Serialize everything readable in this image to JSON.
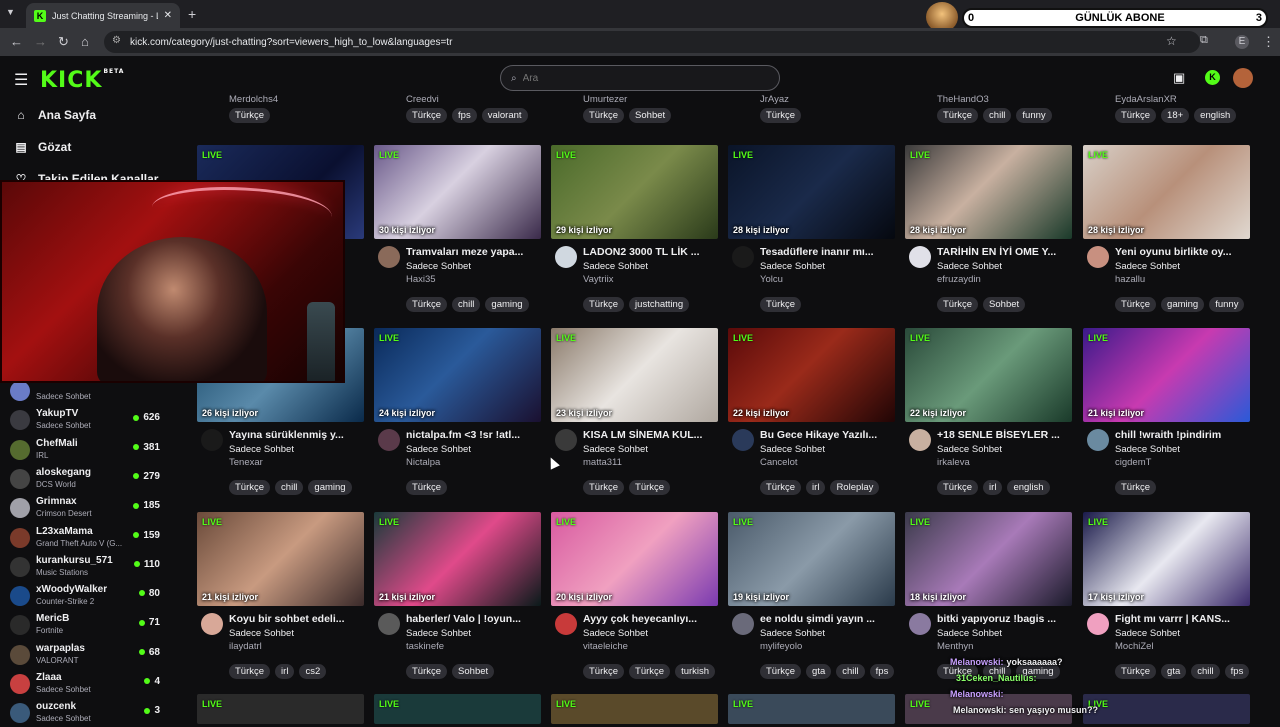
{
  "browser": {
    "tab_title": "Just Chatting Streaming - Live S",
    "url": "kick.com/category/just-chatting?sort=viewers_high_to_low&languages=tr"
  },
  "overlay": {
    "left": "0",
    "center": "GÜNLÜK ABONE",
    "right": "3"
  },
  "header": {
    "logo": "KICK",
    "logo_badge": "BETA",
    "search_placeholder": "Ara"
  },
  "sidebar": {
    "nav": [
      {
        "label": "Ana Sayfa",
        "icon": "home-icon"
      },
      {
        "label": "Gözat",
        "icon": "browse-icon"
      },
      {
        "label": "Takip Edilen Kanallar",
        "icon": "heart-icon"
      }
    ],
    "followed": [
      {
        "name": "",
        "category": "Sadece Sohbet",
        "viewers": "",
        "color": "#6a7cc8"
      },
      {
        "name": "YakupTV",
        "category": "Sadece Sohbet",
        "viewers": "626",
        "color": "#3a3a40"
      },
      {
        "name": "ChefMali",
        "category": "IRL",
        "viewers": "381",
        "color": "#556b2f"
      },
      {
        "name": "aloskegang",
        "category": "DCS World",
        "viewers": "279",
        "color": "#444"
      },
      {
        "name": "Grimnax",
        "category": "Crimson Desert",
        "viewers": "185",
        "color": "#a0a0a8"
      },
      {
        "name": "L23xaMama",
        "category": "Grand Theft Auto V (G...",
        "viewers": "159",
        "color": "#7a3a2a"
      },
      {
        "name": "kurankursu_571",
        "category": "Music Stations",
        "viewers": "110",
        "color": "#333"
      },
      {
        "name": "xWoodyWalker",
        "category": "Counter-Strike 2",
        "viewers": "80",
        "color": "#1a4a8a"
      },
      {
        "name": "MericB",
        "category": "Fortnite",
        "viewers": "71",
        "color": "#2a2a2a"
      },
      {
        "name": "warpaplas",
        "category": "VALORANT",
        "viewers": "68",
        "color": "#5a4a3a"
      },
      {
        "name": "Zlaaa",
        "category": "Sadece Sohbet",
        "viewers": "4",
        "color": "#c84040"
      },
      {
        "name": "ouzcenk",
        "category": "Sadece Sohbet",
        "viewers": "3",
        "color": "#3a5a7a"
      }
    ]
  },
  "top_partial": [
    {
      "chan": "Merdolchs4",
      "tags": [
        "Türkçe"
      ]
    },
    {
      "chan": "Creedvi",
      "tags": [
        "Türkçe",
        "fps",
        "valorant"
      ]
    },
    {
      "chan": "Umurtezer",
      "tags": [
        "Türkçe",
        "Sohbet"
      ]
    },
    {
      "chan": "JrAyaz",
      "tags": [
        "Türkçe"
      ]
    },
    {
      "chan": "TheHandO3",
      "tags": [
        "Türkçe",
        "chill",
        "funny"
      ]
    },
    {
      "chan": "EydaArslanXR",
      "tags": [
        "Türkçe",
        "18+",
        "english"
      ]
    }
  ],
  "live_label": "LIVE",
  "cards": [
    {
      "viewers": "",
      "title": "",
      "category": "",
      "channel": "",
      "tags": [],
      "thumb": "linear-gradient(135deg,#1a2a5a,#0a1030 60%,#2a3a7a)",
      "avatar": "#444"
    },
    {
      "viewers": "30 kişi izliyor",
      "title": "Tramvaları meze yapa...",
      "category": "Sadece Sohbet",
      "channel": "Haxi35",
      "tags": [
        "Türkçe",
        "chill",
        "gaming"
      ],
      "thumb": "linear-gradient(135deg,#6a5a8a,#d8d0e0 45%,#3a2a4a)",
      "avatar": "#8a6a5a"
    },
    {
      "viewers": "29 kişi izliyor",
      "title": "LADON2 3000 TL LİK ...",
      "category": "Sadece Sohbet",
      "channel": "Vaytriix",
      "tags": [
        "Türkçe",
        "justchatting"
      ],
      "thumb": "linear-gradient(135deg,#4a6a2a,#7a8a4a 50%,#2a3a1a)",
      "avatar": "#d0d8e0"
    },
    {
      "viewers": "28 kişi izliyor",
      "title": "Tesadüflere inanır mı...",
      "category": "Sadece Sohbet",
      "channel": "Yolcu",
      "tags": [
        "Türkçe"
      ],
      "thumb": "linear-gradient(135deg,#0a1428,#1a2a4a 50%,#05080f)",
      "avatar": "#1a1a1a"
    },
    {
      "viewers": "28 kişi izliyor",
      "title": "TARİHİN EN İYİ OME Y...",
      "category": "Sadece Sohbet",
      "channel": "efruzaydin",
      "tags": [
        "Türkçe",
        "Sohbet"
      ],
      "thumb": "linear-gradient(135deg,#3a3a3a,#c8b0a0 45%,#1a3a2a)",
      "avatar": "#e0e0e8"
    },
    {
      "viewers": "28 kişi izliyor",
      "title": "Yeni oyunu birlikte oy...",
      "category": "Sadece Sohbet",
      "channel": "hazallu",
      "tags": [
        "Türkçe",
        "gaming",
        "funny"
      ],
      "thumb": "linear-gradient(135deg,#d8d0c8,#b8907a 50%,#e0d8d0)",
      "avatar": "#c89080"
    },
    {
      "viewers": "26 kişi izliyor",
      "title": "Yayına sürüklenmiş y...",
      "category": "Sadece Sohbet",
      "channel": "Tenexar",
      "tags": [
        "Türkçe",
        "chill",
        "gaming"
      ],
      "thumb": "linear-gradient(135deg,#1a4a6a,#5a8aaa 50%,#0a2a4a)",
      "avatar": "#1a1a1a"
    },
    {
      "viewers": "24 kişi izliyor",
      "title": "nictalpa.fm <3 !sr !atl...",
      "category": "Sadece Sohbet",
      "channel": "Nictalpa",
      "tags": [
        "Türkçe"
      ],
      "thumb": "linear-gradient(135deg,#0a2a5a,#2a5a9a 45%,#1a1030)",
      "avatar": "#5a3a4a"
    },
    {
      "viewers": "23 kişi izliyor",
      "title": "KISA LM SİNEMA KUL...",
      "category": "Sadece Sohbet",
      "channel": "matta311",
      "tags": [
        "Türkçe",
        "Türkçe"
      ],
      "thumb": "linear-gradient(135deg,#8a7a6a,#e8e4e0 50%,#b0a8a0)",
      "avatar": "#3a3a3a"
    },
    {
      "viewers": "22 kişi izliyor",
      "title": "Bu Gece Hikaye Yazılı...",
      "category": "Sadece Sohbet",
      "channel": "Cancelot",
      "tags": [
        "Türkçe",
        "irl",
        "Roleplay"
      ],
      "thumb": "linear-gradient(135deg,#5a0a0a,#9a2a1a 45%,#200505)",
      "avatar": "#2a3a5a"
    },
    {
      "viewers": "22 kişi izliyor",
      "title": "+18 SENLE BİSEYLER ...",
      "category": "Sadece Sohbet",
      "channel": "irkaleva",
      "tags": [
        "Türkçe",
        "irl",
        "english"
      ],
      "thumb": "linear-gradient(135deg,#2a4a3a,#6a9a7a 50%,#1a3a2a)",
      "avatar": "#c8b0a0"
    },
    {
      "viewers": "21 kişi izliyor",
      "title": "chill !wraith !pindirim",
      "category": "Sadece Sohbet",
      "channel": "cigdemT",
      "tags": [
        "Türkçe"
      ],
      "thumb": "linear-gradient(135deg,#3a1a8a,#c83ab0 50%,#2a5ad8)",
      "avatar": "#6a8aa0"
    },
    {
      "viewers": "21 kişi izliyor",
      "title": "Koyu bir sohbet edeli...",
      "category": "Sadece Sohbet",
      "channel": "ilaydatrl",
      "tags": [
        "Türkçe",
        "irl",
        "cs2"
      ],
      "thumb": "linear-gradient(135deg,#6a4a3a,#c89a80 50%,#3a2a2a)",
      "avatar": "#d8a898"
    },
    {
      "viewers": "21 kişi izliyor",
      "title": "haberler/ Valo | !oyun...",
      "category": "Sadece Sohbet",
      "channel": "taskinefe",
      "tags": [
        "Türkçe",
        "Sohbet"
      ],
      "thumb": "linear-gradient(135deg,#1a3a3a,#e04a8a 50%,#0a1a1a)",
      "avatar": "#5a5a5a"
    },
    {
      "viewers": "20 kişi izliyor",
      "title": "Ayyy çok heyecanlıyı...",
      "category": "Sadece Sohbet",
      "channel": "vitaeleiche",
      "tags": [
        "Türkçe",
        "Türkçe",
        "turkish"
      ],
      "thumb": "linear-gradient(135deg,#d85aa0,#f0a0c0 50%,#7a3ab0)",
      "avatar": "#c83a3a"
    },
    {
      "viewers": "19 kişi izliyor",
      "title": "ee noldu şimdi yayın ...",
      "category": "Sadece Sohbet",
      "channel": "mylifeyolo",
      "tags": [
        "Türkçe",
        "gta",
        "chill",
        "fps"
      ],
      "thumb": "linear-gradient(135deg,#4a5a6a,#8a9aa8 50%,#2a3a4a)",
      "avatar": "#6a6a7a"
    },
    {
      "viewers": "18 kişi izliyor",
      "title": "bitki yapıyoruz !bagis ...",
      "category": "Sadece Sohbet",
      "channel": "Menthyn",
      "tags": [
        "Türkçe",
        "chill",
        "gaming"
      ],
      "thumb": "linear-gradient(135deg,#3a3a4a,#a87ab8 50%,#1a1a2a)",
      "avatar": "#8a7aa0"
    },
    {
      "viewers": "17 kişi izliyor",
      "title": "Fight mı varrr | KANS...",
      "category": "Sadece Sohbet",
      "channel": "MochiZel",
      "tags": [
        "Türkçe",
        "gta",
        "chill",
        "fps"
      ],
      "thumb": "linear-gradient(135deg,#1a1a4a,#e8e8f0 50%,#3a2a6a)",
      "avatar": "#f0a0c0"
    }
  ],
  "bottom_partial": [
    "#2a2a2a",
    "#1a3a3a",
    "#5a4a2a",
    "#3a4a5a",
    "#4a3a4a",
    "#2a2a4a"
  ],
  "chat": [
    {
      "user": "Melanowski:",
      "msg": "yoksaaaaaa?",
      "color": "#c8a0ff"
    },
    {
      "user": "31Ceken_Nautilus:",
      "msg": "",
      "color": "#8aff6a"
    },
    {
      "user": "Melanowski:",
      "msg": "",
      "color": "#c8a0ff"
    },
    {
      "user": "",
      "msg": "Melanowski: sen yaşıyo musun??",
      "color": "#efeff1"
    }
  ]
}
